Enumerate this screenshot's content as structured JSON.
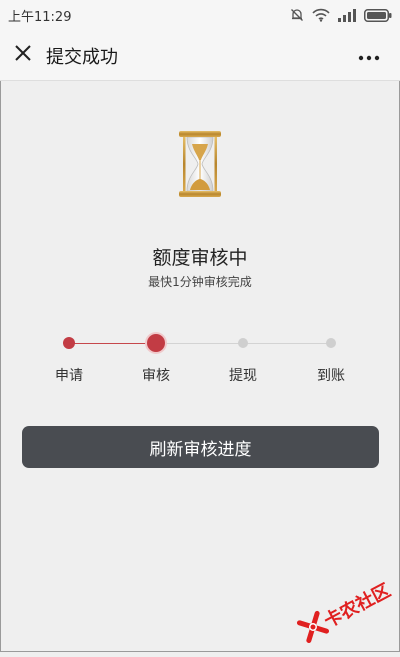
{
  "status_bar": {
    "time": "上午11:29",
    "icons": [
      "dnd-icon",
      "wifi-icon",
      "signal-icon",
      "battery-icon"
    ]
  },
  "header": {
    "title": "提交成功",
    "close_icon": "close-icon",
    "more_icon": "more-icon"
  },
  "main": {
    "title": "额度审核中",
    "subtitle": "最快1分钟审核完成",
    "steps": [
      {
        "label": "申请",
        "state": "done"
      },
      {
        "label": "审核",
        "state": "current"
      },
      {
        "label": "提现",
        "state": "pending"
      },
      {
        "label": "到账",
        "state": "pending"
      }
    ],
    "refresh_button": "刷新审核进度"
  },
  "watermark": {
    "text": "卡农社区"
  },
  "colors": {
    "accent_red": "#c23c44",
    "button_dark": "#494c51",
    "background": "#efefef",
    "pending_gray": "#cfcfcf",
    "hourglass_gold": "#c99a3e"
  }
}
